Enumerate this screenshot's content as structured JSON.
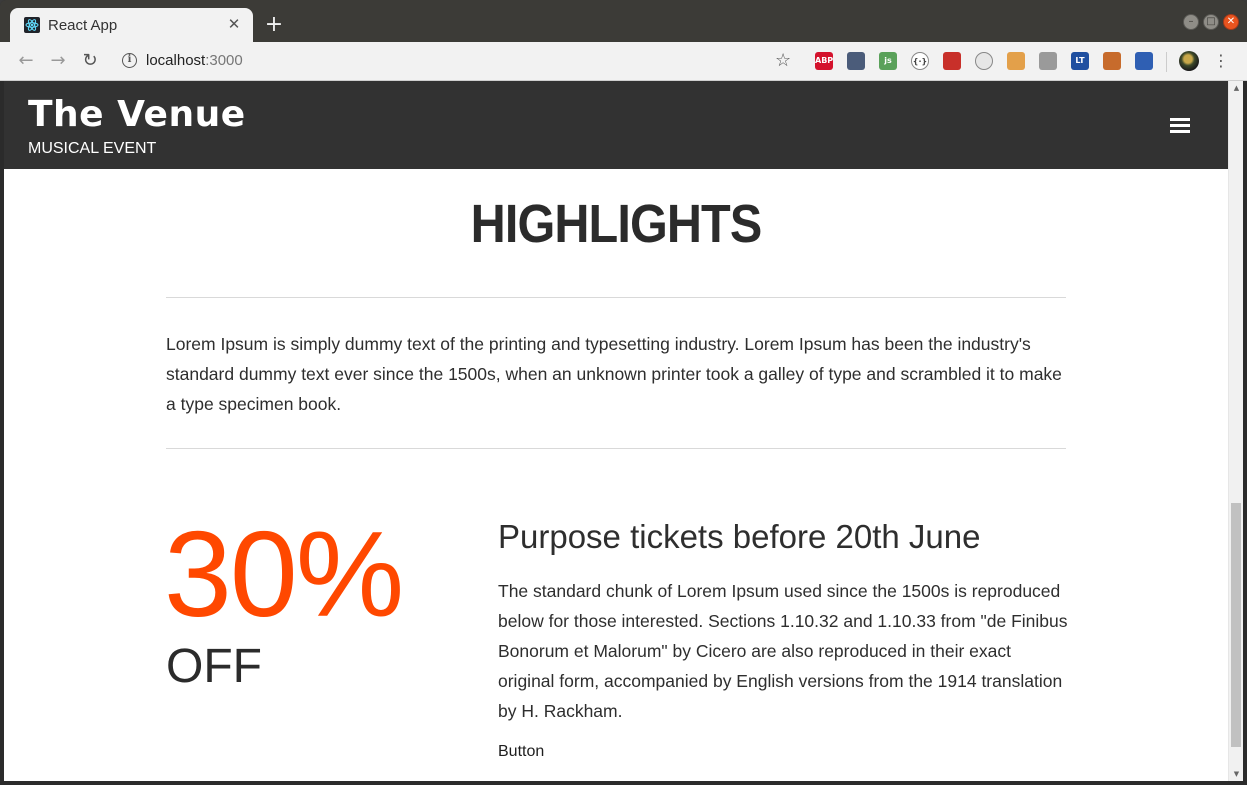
{
  "browser": {
    "tab_title": "React App",
    "tab_close": "✕",
    "new_tab": "+",
    "url_host": "localhost",
    "url_port": ":3000",
    "extensions": [
      {
        "name": "adblock-plus-icon",
        "label": "ABP",
        "color": "#d4122c"
      },
      {
        "name": "colorzilla-icon",
        "label": "",
        "color": "#4b5c7a"
      },
      {
        "name": "js-toggle-icon",
        "label": "js",
        "color": "#5aa15a"
      },
      {
        "name": "code-icon",
        "label": "{·}",
        "color": "#ffffff"
      },
      {
        "name": "devtools-icon",
        "label": "",
        "color": "#c8302a"
      },
      {
        "name": "timer-icon",
        "label": "",
        "color": "#e6e6e6"
      },
      {
        "name": "cookie-icon",
        "label": "",
        "color": "#e3a04a"
      },
      {
        "name": "links-icon",
        "label": "",
        "color": "#9a9a9a"
      },
      {
        "name": "languagetool-icon",
        "label": "LT",
        "color": "#1f4fa0"
      },
      {
        "name": "monkey-icon",
        "label": "",
        "color": "#c76b2c"
      },
      {
        "name": "save-icon",
        "label": "",
        "color": "#2f5fb3"
      }
    ]
  },
  "site": {
    "brand": "The Venue",
    "brand_sub": "MUSICAL EVENT"
  },
  "highlights": {
    "title": "HIGHLIGHTS",
    "intro": "Lorem Ipsum is simply dummy text of the printing and typesetting industry. Lorem Ipsum has been the industry's standard dummy text ever since the 1500s, when an unknown printer took a galley of type and scrambled it to make a type specimen book."
  },
  "promo": {
    "discount": "30%",
    "off": "OFF",
    "title": "Purpose tickets before 20th June",
    "text": "The standard chunk of Lorem Ipsum used since the 1500s is reproduced below for those interested. Sections 1.10.32 and 1.10.33 from \"de Finibus Bonorum et Malorum\" by Cicero are also reproduced in their exact original form, accompanied by English versions from the 1914 translation by H. Rackham.",
    "button": "Button"
  },
  "colors": {
    "accent": "#ff4800",
    "header_bg": "#323232"
  }
}
